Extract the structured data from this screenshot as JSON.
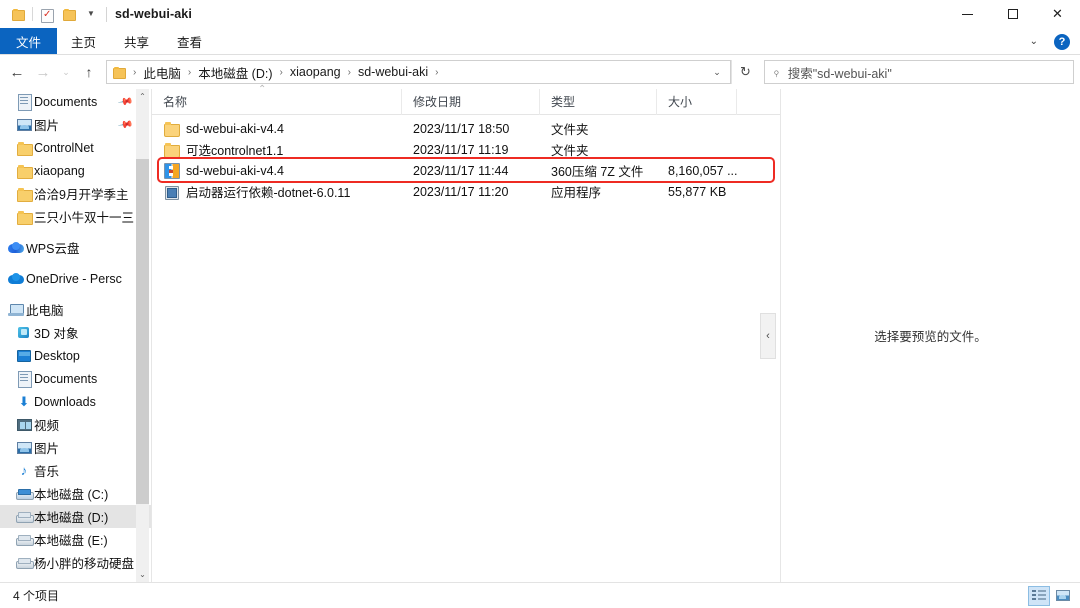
{
  "window": {
    "title": "sd-webui-aki",
    "quick_access": [
      "folder-icon",
      "properties-icon",
      "new-folder-icon",
      "customize-caret"
    ],
    "controls": {
      "minimize": "minimize-icon",
      "maximize": "maximize-icon",
      "close": "close-icon"
    }
  },
  "ribbon": {
    "tabs": [
      {
        "label": "文件",
        "active": true
      },
      {
        "label": "主页",
        "active": false
      },
      {
        "label": "共享",
        "active": false
      },
      {
        "label": "查看",
        "active": false
      }
    ],
    "expand_icon": "chevron-down-icon",
    "help_label": "?"
  },
  "address": {
    "back_icon": "arrow-left-icon",
    "forward_icon": "arrow-right-icon",
    "recent_icon": "chevron-down-icon",
    "up_icon": "arrow-up-icon",
    "breadcrumbs": [
      "此电脑",
      "本地磁盘 (D:)",
      "xiaopang",
      "sd-webui-aki"
    ],
    "separator": "›",
    "dropdown_icon": "chevron-down-icon",
    "refresh_icon": "refresh-icon"
  },
  "search": {
    "icon": "search-icon",
    "placeholder": "搜索\"sd-webui-aki\""
  },
  "sidebar": {
    "items": [
      {
        "label": "Documents",
        "icon": "document-icon",
        "indent": 2,
        "pinned": true,
        "selected": false
      },
      {
        "label": "图片",
        "icon": "picture-icon",
        "indent": 2,
        "pinned": true,
        "selected": false
      },
      {
        "label": "ControlNet",
        "icon": "folder-icon",
        "indent": 2,
        "pinned": false,
        "selected": false
      },
      {
        "label": "xiaopang",
        "icon": "folder-icon",
        "indent": 2,
        "pinned": false,
        "selected": false
      },
      {
        "label": "洽洽9月开学季主",
        "icon": "folder-icon",
        "indent": 2,
        "pinned": false,
        "selected": false
      },
      {
        "label": "三只小牛双十一三",
        "icon": "folder-icon",
        "indent": 2,
        "pinned": false,
        "selected": false
      },
      {
        "label": "WPS云盘",
        "icon": "cloud-wps-icon",
        "indent": 1,
        "pinned": false,
        "selected": false,
        "gap_before": true
      },
      {
        "label": "OneDrive - Persc",
        "icon": "cloud-onedrive-icon",
        "indent": 1,
        "pinned": false,
        "selected": false,
        "gap_before": true
      },
      {
        "label": "此电脑",
        "icon": "this-pc-icon",
        "indent": 1,
        "pinned": false,
        "selected": false,
        "gap_before": true
      },
      {
        "label": "3D 对象",
        "icon": "3d-objects-icon",
        "indent": 2,
        "pinned": false,
        "selected": false
      },
      {
        "label": "Desktop",
        "icon": "desktop-icon",
        "indent": 2,
        "pinned": false,
        "selected": false
      },
      {
        "label": "Documents",
        "icon": "document-icon",
        "indent": 2,
        "pinned": false,
        "selected": false
      },
      {
        "label": "Downloads",
        "icon": "downloads-icon",
        "indent": 2,
        "pinned": false,
        "selected": false
      },
      {
        "label": "视频",
        "icon": "videos-icon",
        "indent": 2,
        "pinned": false,
        "selected": false
      },
      {
        "label": "图片",
        "icon": "picture-icon",
        "indent": 2,
        "pinned": false,
        "selected": false
      },
      {
        "label": "音乐",
        "icon": "music-icon",
        "indent": 2,
        "pinned": false,
        "selected": false
      },
      {
        "label": "本地磁盘 (C:)",
        "icon": "system-drive-icon",
        "indent": 2,
        "pinned": false,
        "selected": false
      },
      {
        "label": "本地磁盘 (D:)",
        "icon": "drive-icon",
        "indent": 2,
        "pinned": false,
        "selected": true
      },
      {
        "label": "本地磁盘 (E:)",
        "icon": "drive-icon",
        "indent": 2,
        "pinned": false,
        "selected": false
      },
      {
        "label": "杨小胖的移动硬盘",
        "icon": "drive-icon",
        "indent": 2,
        "pinned": false,
        "selected": false
      }
    ],
    "scroll_up_icon": "chevron-up-icon",
    "scroll_down_icon": "chevron-down-icon"
  },
  "filelist": {
    "columns": [
      {
        "key": "name",
        "label": "名称",
        "sorted": true,
        "sort_dir": "asc"
      },
      {
        "key": "date",
        "label": "修改日期",
        "sorted": false
      },
      {
        "key": "type",
        "label": "类型",
        "sorted": false
      },
      {
        "key": "size",
        "label": "大小",
        "sorted": false
      }
    ],
    "sort_caret": "▲",
    "rows": [
      {
        "name": "sd-webui-aki-v4.4",
        "date": "2023/11/17 18:50",
        "type": "文件夹",
        "size": "",
        "icon": "folder-icon",
        "highlighted": false
      },
      {
        "name": "可选controlnet1.1",
        "date": "2023/11/17 11:19",
        "type": "文件夹",
        "size": "",
        "icon": "folder-icon",
        "highlighted": false
      },
      {
        "name": "sd-webui-aki-v4.4",
        "date": "2023/11/17 11:44",
        "type": "360压缩 7Z 文件",
        "size": "8,160,057 ...",
        "icon": "archive-7z-icon",
        "highlighted": true
      },
      {
        "name": "启动器运行依赖-dotnet-6.0.11",
        "date": "2023/11/17 11:20",
        "type": "应用程序",
        "size": "55,877 KB",
        "icon": "application-icon",
        "highlighted": false
      }
    ],
    "annotation_color": "#ee2b23"
  },
  "preview": {
    "message": "选择要预览的文件。",
    "collapse_icon": "‹"
  },
  "statusbar": {
    "item_count": "4 个项目",
    "view_details_icon": "details-view-icon",
    "view_large_icons_icon": "large-icons-view-icon"
  }
}
